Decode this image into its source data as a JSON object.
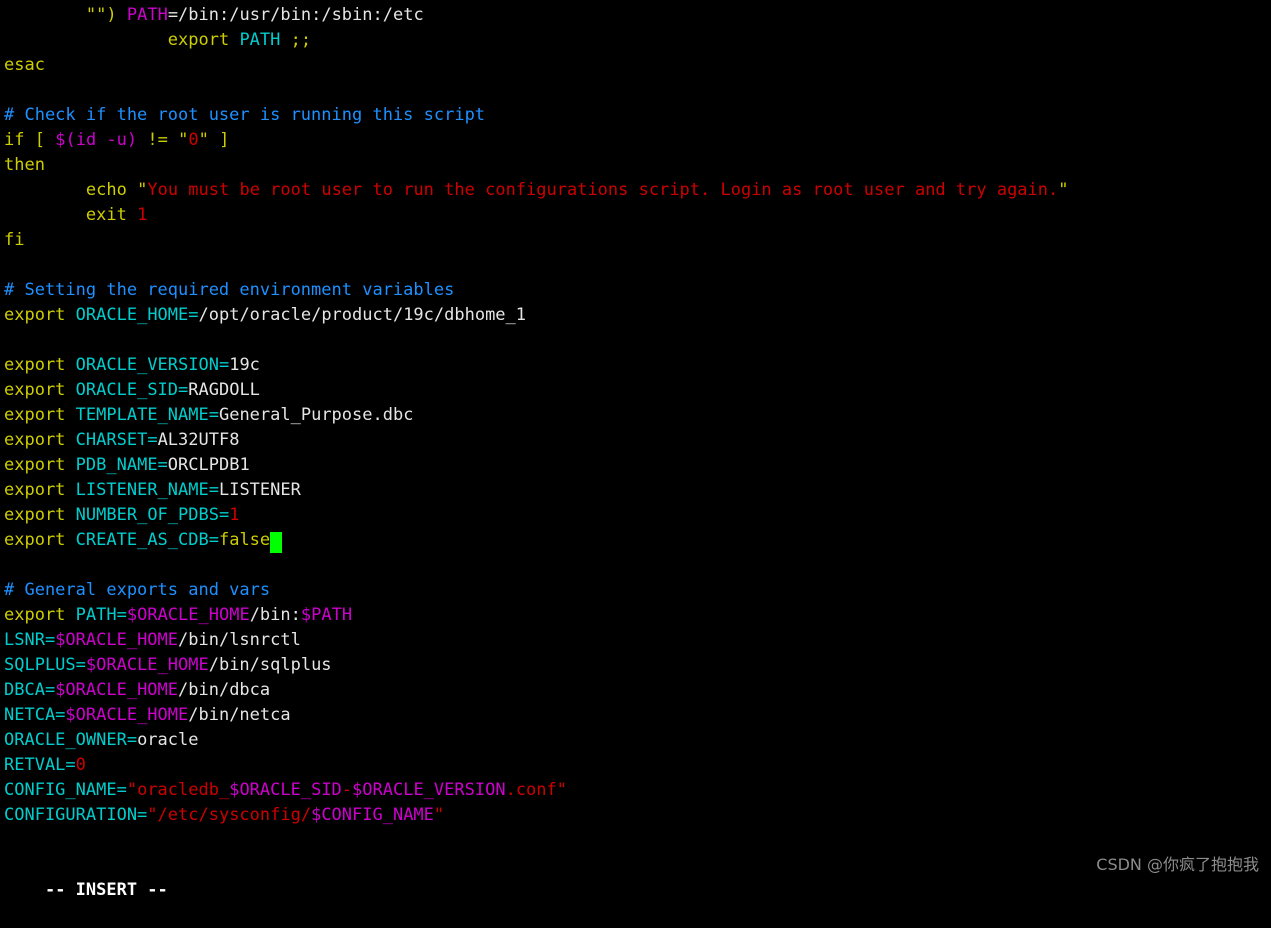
{
  "editor": {
    "name": "vim",
    "mode_indicator": "-- INSERT --",
    "background_color": "#000000",
    "cursor_color": "#00FF00",
    "colors": {
      "keyword": "#CDCD00",
      "variable_name": "#00CDCD",
      "plain_text": "#E5E5E5",
      "string": "#CD0000",
      "number": "#CD0000",
      "expansion": "#CD00CD",
      "comment": "#1E90FF"
    }
  },
  "watermark": {
    "text": "CSDN @你疯了抱抱我"
  },
  "lines": [
    {
      "index": 0,
      "text": "        \"\") PATH=/bin:/usr/bin:/sbin:/etc",
      "spans": [
        {
          "t": "        ",
          "c": "txt"
        },
        {
          "t": "\"\"",
          "c": "kw"
        },
        {
          "t": ") ",
          "c": "kw"
        },
        {
          "t": "PATH",
          "c": "ident"
        },
        {
          "t": "=/bin:/usr/bin:/sbin:/etc",
          "c": "txt"
        }
      ]
    },
    {
      "index": 1,
      "text": "                export PATH ;;",
      "spans": [
        {
          "t": "                ",
          "c": "txt"
        },
        {
          "t": "export",
          "c": "kw"
        },
        {
          "t": " ",
          "c": "txt"
        },
        {
          "t": "PATH",
          "c": "var"
        },
        {
          "t": " ",
          "c": "txt"
        },
        {
          "t": ";;",
          "c": "kw"
        }
      ]
    },
    {
      "index": 2,
      "text": "esac",
      "spans": [
        {
          "t": "esac",
          "c": "kw"
        }
      ]
    },
    {
      "index": 3,
      "text": "",
      "spans": []
    },
    {
      "index": 4,
      "text": "# Check if the root user is running this script",
      "spans": [
        {
          "t": "# Check if the root user is running this script",
          "c": "cmt"
        }
      ]
    },
    {
      "index": 5,
      "text": "if [ $(id -u) != \"0\" ]",
      "spans": [
        {
          "t": "if",
          "c": "kw"
        },
        {
          "t": " ",
          "c": "txt"
        },
        {
          "t": "[",
          "c": "kw"
        },
        {
          "t": " ",
          "c": "txt"
        },
        {
          "t": "$(id -u)",
          "c": "ident"
        },
        {
          "t": " ",
          "c": "txt"
        },
        {
          "t": "!=",
          "c": "kw"
        },
        {
          "t": " ",
          "c": "txt"
        },
        {
          "t": "\"",
          "c": "kw"
        },
        {
          "t": "0",
          "c": "num"
        },
        {
          "t": "\"",
          "c": "kw"
        },
        {
          "t": " ",
          "c": "txt"
        },
        {
          "t": "]",
          "c": "kw"
        }
      ]
    },
    {
      "index": 6,
      "text": "then",
      "spans": [
        {
          "t": "then",
          "c": "kw"
        }
      ]
    },
    {
      "index": 7,
      "text": "        echo \"You must be root user to run the configurations script. Login as root user and try again.\"",
      "spans": [
        {
          "t": "        ",
          "c": "txt"
        },
        {
          "t": "echo",
          "c": "kw"
        },
        {
          "t": " ",
          "c": "txt"
        },
        {
          "t": "\"",
          "c": "kw"
        },
        {
          "t": "You must be root user to run the configurations script. Login as root user and try again.",
          "c": "str"
        },
        {
          "t": "\"",
          "c": "kw"
        }
      ]
    },
    {
      "index": 8,
      "text": "        exit 1",
      "spans": [
        {
          "t": "        ",
          "c": "txt"
        },
        {
          "t": "exit",
          "c": "kw"
        },
        {
          "t": " ",
          "c": "txt"
        },
        {
          "t": "1",
          "c": "num"
        }
      ]
    },
    {
      "index": 9,
      "text": "fi",
      "spans": [
        {
          "t": "fi",
          "c": "kw"
        }
      ]
    },
    {
      "index": 10,
      "text": "",
      "spans": []
    },
    {
      "index": 11,
      "text": "# Setting the required environment variables",
      "spans": [
        {
          "t": "# Setting the required environment variables",
          "c": "cmt"
        }
      ]
    },
    {
      "index": 12,
      "text": "export ORACLE_HOME=/opt/oracle/product/19c/dbhome_1",
      "spans": [
        {
          "t": "export",
          "c": "kw"
        },
        {
          "t": " ",
          "c": "txt"
        },
        {
          "t": "ORACLE_HOME=",
          "c": "var"
        },
        {
          "t": "/opt/oracle/product/19c/dbhome_1",
          "c": "txt"
        }
      ]
    },
    {
      "index": 13,
      "text": "",
      "spans": []
    },
    {
      "index": 14,
      "text": "export ORACLE_VERSION=19c",
      "spans": [
        {
          "t": "export",
          "c": "kw"
        },
        {
          "t": " ",
          "c": "txt"
        },
        {
          "t": "ORACLE_VERSION=",
          "c": "var"
        },
        {
          "t": "19c",
          "c": "txt"
        }
      ]
    },
    {
      "index": 15,
      "text": "export ORACLE_SID=RAGDOLL",
      "spans": [
        {
          "t": "export",
          "c": "kw"
        },
        {
          "t": " ",
          "c": "txt"
        },
        {
          "t": "ORACLE_SID=",
          "c": "var"
        },
        {
          "t": "RAGDOLL",
          "c": "txt"
        }
      ]
    },
    {
      "index": 16,
      "text": "export TEMPLATE_NAME=General_Purpose.dbc",
      "spans": [
        {
          "t": "export",
          "c": "kw"
        },
        {
          "t": " ",
          "c": "txt"
        },
        {
          "t": "TEMPLATE_NAME=",
          "c": "var"
        },
        {
          "t": "General_Purpose.dbc",
          "c": "txt"
        }
      ]
    },
    {
      "index": 17,
      "text": "export CHARSET=AL32UTF8",
      "spans": [
        {
          "t": "export",
          "c": "kw"
        },
        {
          "t": " ",
          "c": "txt"
        },
        {
          "t": "CHARSET=",
          "c": "var"
        },
        {
          "t": "AL32UTF8",
          "c": "txt"
        }
      ]
    },
    {
      "index": 18,
      "text": "export PDB_NAME=ORCLPDB1",
      "spans": [
        {
          "t": "export",
          "c": "kw"
        },
        {
          "t": " ",
          "c": "txt"
        },
        {
          "t": "PDB_NAME=",
          "c": "var"
        },
        {
          "t": "ORCLPDB1",
          "c": "txt"
        }
      ]
    },
    {
      "index": 19,
      "text": "export LISTENER_NAME=LISTENER",
      "spans": [
        {
          "t": "export",
          "c": "kw"
        },
        {
          "t": " ",
          "c": "txt"
        },
        {
          "t": "LISTENER_NAME=",
          "c": "var"
        },
        {
          "t": "LISTENER",
          "c": "txt"
        }
      ]
    },
    {
      "index": 20,
      "text": "export NUMBER_OF_PDBS=1",
      "spans": [
        {
          "t": "export",
          "c": "kw"
        },
        {
          "t": " ",
          "c": "txt"
        },
        {
          "t": "NUMBER_OF_PDBS=",
          "c": "var"
        },
        {
          "t": "1",
          "c": "num"
        }
      ]
    },
    {
      "index": 21,
      "text": "export CREATE_AS_CDB=false",
      "has_cursor": true,
      "spans": [
        {
          "t": "export",
          "c": "kw"
        },
        {
          "t": " ",
          "c": "txt"
        },
        {
          "t": "CREATE_AS_CDB=",
          "c": "var"
        },
        {
          "t": "false",
          "c": "kw"
        }
      ]
    },
    {
      "index": 22,
      "text": "",
      "spans": []
    },
    {
      "index": 23,
      "text": "# General exports and vars",
      "spans": [
        {
          "t": "# General exports and vars",
          "c": "cmt"
        }
      ]
    },
    {
      "index": 24,
      "text": "export PATH=$ORACLE_HOME/bin:$PATH",
      "spans": [
        {
          "t": "export",
          "c": "kw"
        },
        {
          "t": " ",
          "c": "txt"
        },
        {
          "t": "PATH=",
          "c": "var"
        },
        {
          "t": "$ORACLE_HOME",
          "c": "ident"
        },
        {
          "t": "/bin:",
          "c": "txt"
        },
        {
          "t": "$PATH",
          "c": "ident"
        }
      ]
    },
    {
      "index": 25,
      "text": "LSNR=$ORACLE_HOME/bin/lsnrctl",
      "spans": [
        {
          "t": "LSNR=",
          "c": "var"
        },
        {
          "t": "$ORACLE_HOME",
          "c": "ident"
        },
        {
          "t": "/bin/lsnrctl",
          "c": "txt"
        }
      ]
    },
    {
      "index": 26,
      "text": "SQLPLUS=$ORACLE_HOME/bin/sqlplus",
      "spans": [
        {
          "t": "SQLPLUS=",
          "c": "var"
        },
        {
          "t": "$ORACLE_HOME",
          "c": "ident"
        },
        {
          "t": "/bin/sqlplus",
          "c": "txt"
        }
      ]
    },
    {
      "index": 27,
      "text": "DBCA=$ORACLE_HOME/bin/dbca",
      "spans": [
        {
          "t": "DBCA=",
          "c": "var"
        },
        {
          "t": "$ORACLE_HOME",
          "c": "ident"
        },
        {
          "t": "/bin/dbca",
          "c": "txt"
        }
      ]
    },
    {
      "index": 28,
      "text": "NETCA=$ORACLE_HOME/bin/netca",
      "spans": [
        {
          "t": "NETCA=",
          "c": "var"
        },
        {
          "t": "$ORACLE_HOME",
          "c": "ident"
        },
        {
          "t": "/bin/netca",
          "c": "txt"
        }
      ]
    },
    {
      "index": 29,
      "text": "ORACLE_OWNER=oracle",
      "spans": [
        {
          "t": "ORACLE_OWNER=",
          "c": "var"
        },
        {
          "t": "oracle",
          "c": "txt"
        }
      ]
    },
    {
      "index": 30,
      "text": "RETVAL=0",
      "spans": [
        {
          "t": "RETVAL=",
          "c": "var"
        },
        {
          "t": "0",
          "c": "num"
        }
      ]
    },
    {
      "index": 31,
      "text": "CONFIG_NAME=\"oracledb_$ORACLE_SID-$ORACLE_VERSION.conf\"",
      "spans": [
        {
          "t": "CONFIG_NAME=",
          "c": "var"
        },
        {
          "t": "\"",
          "c": "str"
        },
        {
          "t": "oracledb_",
          "c": "str"
        },
        {
          "t": "$ORACLE_SID",
          "c": "ident"
        },
        {
          "t": "-",
          "c": "str"
        },
        {
          "t": "$ORACLE_VERSION",
          "c": "ident"
        },
        {
          "t": ".conf",
          "c": "str"
        },
        {
          "t": "\"",
          "c": "str"
        }
      ]
    },
    {
      "index": 32,
      "text": "CONFIGURATION=\"/etc/sysconfig/$CONFIG_NAME\"",
      "spans": [
        {
          "t": "CONFIGURATION=",
          "c": "var"
        },
        {
          "t": "\"",
          "c": "str"
        },
        {
          "t": "/etc/sysconfig/",
          "c": "str"
        },
        {
          "t": "$CONFIG_NAME",
          "c": "ident"
        },
        {
          "t": "\"",
          "c": "str"
        }
      ]
    }
  ]
}
